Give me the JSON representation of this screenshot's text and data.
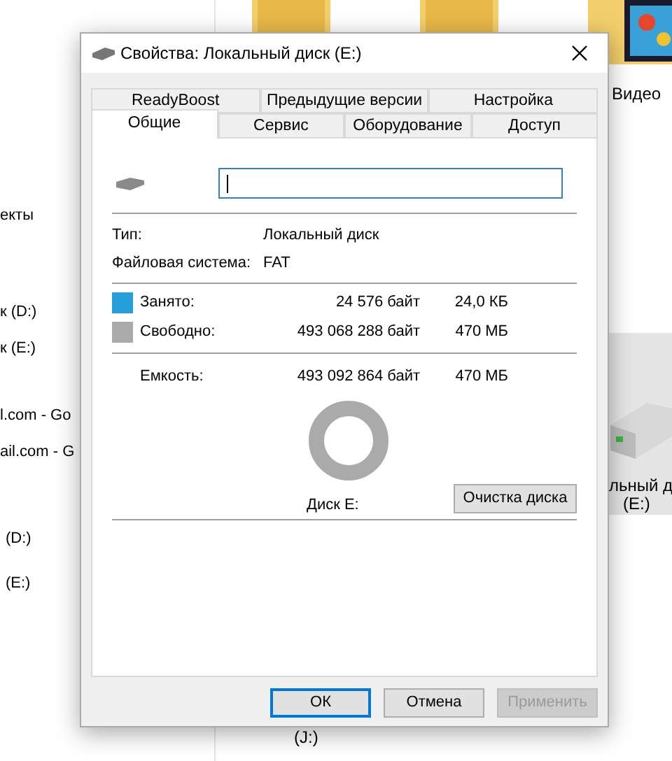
{
  "background": {
    "nav_items": [
      "екты",
      "к (D:)",
      "к (E:)",
      "l.com - Go",
      "ail.com - G",
      "(D:)",
      "(E:)"
    ],
    "folder_label": "Видео",
    "drive_label": [
      "льный д",
      "(E:)"
    ],
    "hidden_label": "(J:)"
  },
  "window": {
    "title": "Свойства: Локальный диск (E:)"
  },
  "tab_rows": [
    [
      {
        "label": "ReadyBoost",
        "selected": false
      },
      {
        "label": "Предыдущие версии",
        "selected": false
      },
      {
        "label": "Настройка",
        "selected": false
      }
    ],
    [
      {
        "label": "Общие",
        "selected": true
      },
      {
        "label": "Сервис",
        "selected": false
      },
      {
        "label": "Оборудование",
        "selected": false
      },
      {
        "label": "Доступ",
        "selected": false
      }
    ]
  ],
  "info": [
    {
      "label": "Тип:",
      "value": "Локальный диск"
    },
    {
      "label": "Файловая система:",
      "value": "FAT"
    }
  ],
  "usage": [
    {
      "label": "Занято:",
      "bytes": "24 576 байт",
      "size": "24,0 КБ",
      "color": "#26a0da"
    },
    {
      "label": "Свободно:",
      "bytes": "493 068 288 байт",
      "size": "470 МБ",
      "color": "#aaaaaa"
    }
  ],
  "capacity": {
    "label": "Емкость:",
    "bytes": "493 092 864 байт",
    "size": "470 МБ"
  },
  "disk_label": "Диск E:",
  "cleanup_button": "Очистка диска",
  "buttons": [
    {
      "label": "ОК",
      "default": true,
      "disabled": false
    },
    {
      "label": "Отмена",
      "default": false,
      "disabled": false
    },
    {
      "label": "Применить",
      "default": false,
      "disabled": true
    }
  ]
}
